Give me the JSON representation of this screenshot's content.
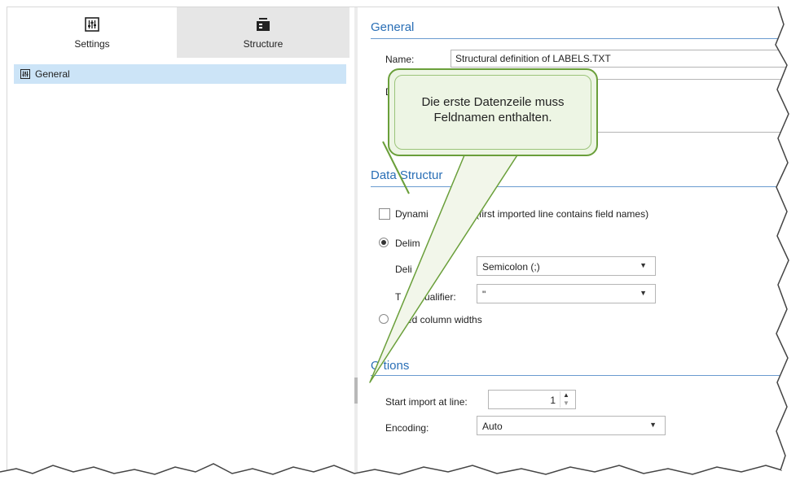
{
  "tabs": [
    {
      "label": "Settings",
      "icon": "settings-sliders-icon",
      "active": true
    },
    {
      "label": "Structure",
      "icon": "structure-icon",
      "active": false
    }
  ],
  "tree": {
    "items": [
      {
        "label": "General",
        "icon": "settings-sliders-icon",
        "selected": true
      }
    ]
  },
  "general": {
    "title": "General",
    "name_label": "Name:",
    "name_value": "Structural definition of LABELS.TXT",
    "description_label": "D"
  },
  "data_structure": {
    "title": "Data Structur",
    "dynamic_label": "Dynami",
    "dynamic_suffix": "e (first imported line contains field names)",
    "dynamic_checked": false,
    "delimited_label": "Delim",
    "delimited_selected": true,
    "delimiter_label": "Deli",
    "delimiter_value": "Semicolon (;)",
    "text_qualifier_label": "T",
    "text_qualifier_label2": "ualifier:",
    "text_qualifier_value": "\"",
    "fixed_label": "ed column widths",
    "fixed_selected": false
  },
  "options": {
    "title_first": "O",
    "title_rest": "tions",
    "start_label": "Start import at line:",
    "start_value": "1",
    "encoding_label": "Encoding:",
    "encoding_value": "Auto"
  },
  "callout": {
    "line1": "Die erste Datenzeile muss",
    "line2": "Feldnamen enthalten."
  },
  "colors": {
    "accent": "#2a6fb6",
    "selection": "#cce4f7",
    "callout_border": "#6a9f3a",
    "callout_fill": "#edf5e4"
  }
}
